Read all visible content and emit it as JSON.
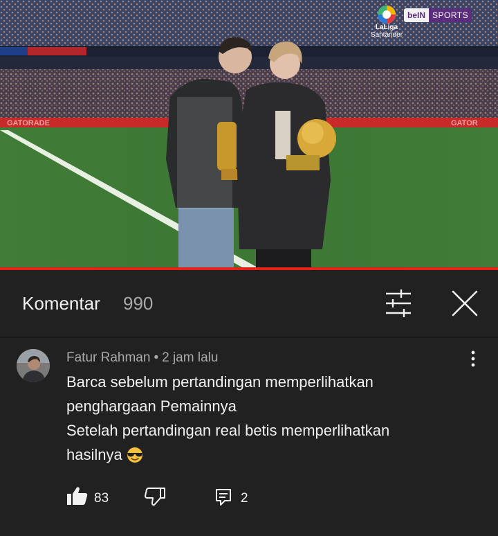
{
  "video": {
    "broadcaster_logo": "beIN",
    "broadcaster_logo_suffix": "SPORTS",
    "league_logo_line1": "LaLiga",
    "league_logo_line2": "Santander",
    "progress_fraction": 1.0,
    "accent_color": "#e62117"
  },
  "comments_panel": {
    "title": "Komentar",
    "count": "990",
    "filter_icon": "sliders-icon",
    "close_icon": "close-icon"
  },
  "comment": {
    "author": "Fatur Rahman",
    "separator": "•",
    "time": "2 jam lalu",
    "lines": [
      "Barca sebelum pertandingan memperlihatkan",
      "penghargaan Pemainnya",
      "Setelah pertandingan real betis memperlihatkan",
      "hasilnya"
    ],
    "emoji": "sunglasses-emoji",
    "likes": "83",
    "replies": "2",
    "more_icon": "vertical-dots-icon",
    "like_icon": "thumbs-up-icon",
    "dislike_icon": "thumbs-down-icon",
    "reply_icon": "reply-icon"
  }
}
